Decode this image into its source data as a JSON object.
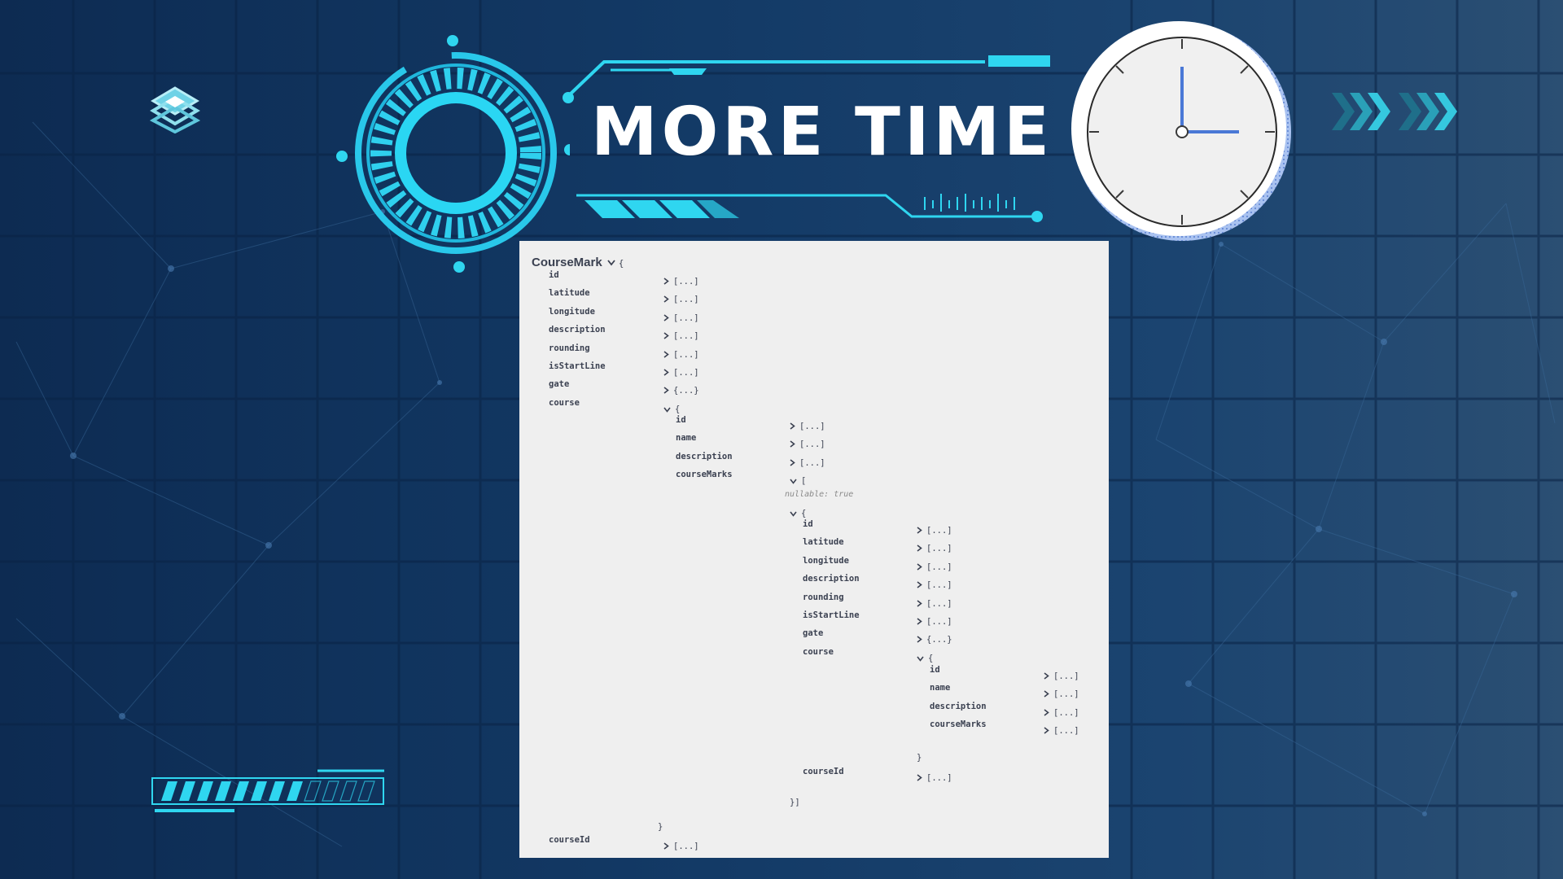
{
  "banner": {
    "title": "MORE TIME"
  },
  "icons": {
    "logo": "stacked-layers-icon",
    "clock": "clock-icon",
    "chevrons": "chevrons-right-icon",
    "ring": "tech-ring-icon"
  },
  "colors": {
    "accent": "#2fd6f0",
    "panel": "#efefef",
    "text": "#3b4151",
    "clock_hand": "#4a78d6"
  },
  "loading_bar": {
    "filled_segments": 8,
    "total_segments": 12
  },
  "schema": {
    "title": "CourseMark",
    "open_brace": "{",
    "rows": [
      {
        "name": "id",
        "value": "[...]",
        "open": false
      },
      {
        "name": "latitude",
        "value": "[...]",
        "open": false
      },
      {
        "name": "longitude",
        "value": "[...]",
        "open": false
      },
      {
        "name": "description",
        "value": "[...]",
        "open": false
      },
      {
        "name": "rounding",
        "value": "[...]",
        "open": false
      },
      {
        "name": "isStartLine",
        "value": "[...]",
        "open": false
      },
      {
        "name": "gate",
        "value": "{...}",
        "open": false
      },
      {
        "name": "course",
        "value": "{",
        "open": true
      }
    ],
    "course": {
      "rows": [
        {
          "name": "id",
          "value": "[...]",
          "open": false
        },
        {
          "name": "name",
          "value": "[...]",
          "open": false
        },
        {
          "name": "description",
          "value": "[...]",
          "open": false
        },
        {
          "name": "courseMarks",
          "value": "[",
          "open": true
        }
      ],
      "nullable_note": "nullable: true",
      "item_open": "{",
      "item": {
        "rows": [
          {
            "name": "id",
            "value": "[...]",
            "open": false
          },
          {
            "name": "latitude",
            "value": "[...]",
            "open": false
          },
          {
            "name": "longitude",
            "value": "[...]",
            "open": false
          },
          {
            "name": "description",
            "value": "[...]",
            "open": false
          },
          {
            "name": "rounding",
            "value": "[...]",
            "open": false
          },
          {
            "name": "isStartLine",
            "value": "[...]",
            "open": false
          },
          {
            "name": "gate",
            "value": "{...}",
            "open": false
          },
          {
            "name": "course",
            "value": "{",
            "open": true
          }
        ],
        "course": {
          "rows": [
            {
              "name": "id",
              "value": "[...]",
              "open": false
            },
            {
              "name": "name",
              "value": "[...]",
              "open": false
            },
            {
              "name": "description",
              "value": "[...]",
              "open": false
            },
            {
              "name": "courseMarks",
              "value": "[...]",
              "open": false
            }
          ],
          "close": "}"
        },
        "courseId": {
          "name": "courseId",
          "value": "[...]"
        },
        "close": "}]"
      },
      "close": "}"
    },
    "courseId": {
      "name": "courseId",
      "value": "[...]"
    }
  }
}
